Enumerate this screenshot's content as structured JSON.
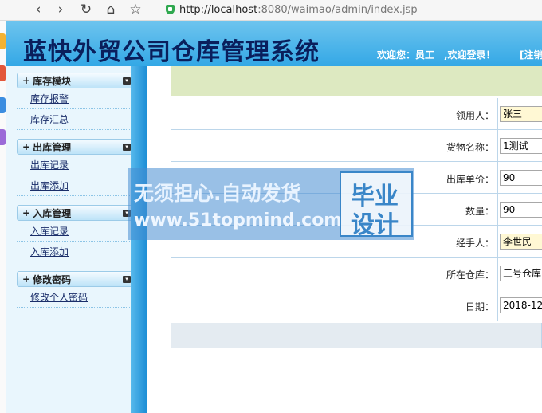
{
  "browser": {
    "url_host": "http://localhost",
    "url_path": ":8080/waimao/admin/index.jsp",
    "back_glyph": "‹",
    "forward_glyph": "›",
    "reload_glyph": "↻",
    "home_glyph": "⌂",
    "star_glyph": "☆"
  },
  "header": {
    "title": "蓝快外贸公司仓库管理系统",
    "welcome": "欢迎您：员工　,欢迎登录！",
    "logout": "[注销"
  },
  "sidebar": {
    "groups": [
      {
        "label": "库存模块",
        "items": [
          "库存报警",
          "库存汇总"
        ]
      },
      {
        "label": "出库管理",
        "items": [
          "出库记录",
          "出库添加"
        ]
      },
      {
        "label": "入库管理",
        "items": [
          "入库记录",
          "入库添加"
        ]
      },
      {
        "label": "修改密码",
        "items": [
          "修改个人密码"
        ]
      }
    ],
    "plus_glyph": "+",
    "collapse_glyph": "▾"
  },
  "form": {
    "rows": [
      {
        "label": "领用人：",
        "value": "张三",
        "filled": true
      },
      {
        "label": "货物名称：",
        "value": "1测试",
        "filled": false
      },
      {
        "label": "出库单价：",
        "value": "90",
        "filled": false
      },
      {
        "label": "数量：",
        "value": "90",
        "filled": false
      },
      {
        "label": "经手人：",
        "value": "李世民",
        "filled": true
      },
      {
        "label": "所在仓库：",
        "value": "三号仓库",
        "filled": false
      },
      {
        "label": "日期：",
        "value": "2018-12-",
        "filled": false
      }
    ]
  },
  "watermark": {
    "line1": "无须担心.自动发货",
    "line2": "www.51topmind.com",
    "box_line1": "毕业",
    "box_line2": "设计"
  },
  "colors": {
    "header_bg": "#33a8e6",
    "title": "#0a1f5c",
    "sidebar_bg": "#e9f6fd",
    "topbar": "#dde9c1",
    "input_highlight": "#fff8d4"
  }
}
